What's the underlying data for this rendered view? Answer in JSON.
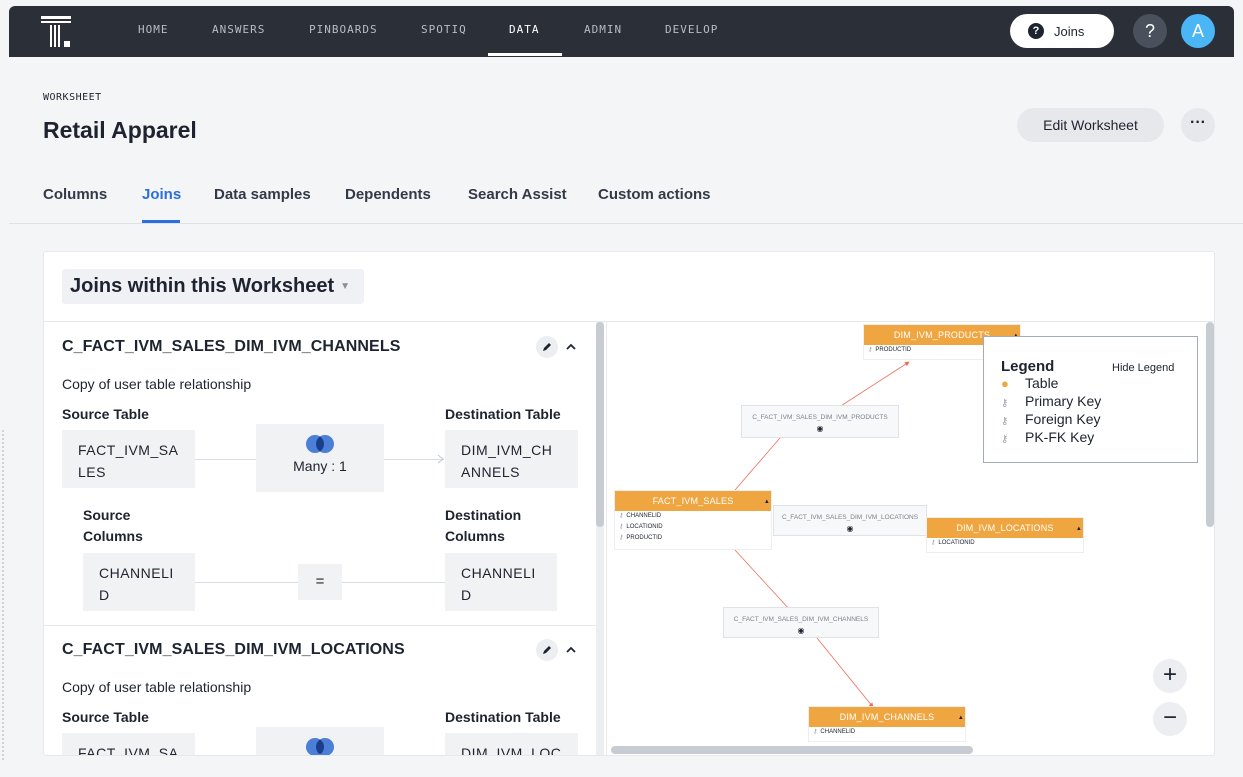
{
  "nav": {
    "items": [
      "HOME",
      "ANSWERS",
      "PINBOARDS",
      "SPOTIQ",
      "DATA",
      "ADMIN",
      "DEVELOP"
    ],
    "active": "DATA",
    "joins_pill": "Joins",
    "help": "?",
    "avatar": "A"
  },
  "header": {
    "breadcrumb": "WORKSHEET",
    "title": "Retail Apparel",
    "edit_button": "Edit Worksheet",
    "more_button": "···"
  },
  "tabs": [
    "Columns",
    "Joins",
    "Data samples",
    "Dependents",
    "Search Assist",
    "Custom actions"
  ],
  "active_tab": "Joins",
  "panel": {
    "dropdown": "Joins within this Worksheet",
    "joins": [
      {
        "name": "C_FACT_IVM_SALES_DIM_IVM_CHANNELS",
        "description": "Copy of user table relationship",
        "source_label": "Source Table",
        "destination_label": "Destination Table",
        "source_table": [
          "FACT_IVM_SA",
          "LES"
        ],
        "cardinality": "Many : 1",
        "destination_table": [
          "DIM_IVM_CH",
          "ANNELS"
        ],
        "source_columns_label": [
          "Source",
          "Columns"
        ],
        "destination_columns_label": [
          "Destination",
          "Columns"
        ],
        "source_column": [
          "CHANNELI",
          "D"
        ],
        "operator": "=",
        "destination_column": [
          "CHANNELI",
          "D"
        ]
      },
      {
        "name": "C_FACT_IVM_SALES_DIM_IVM_LOCATIONS",
        "description": "Copy of user table relationship",
        "source_label": "Source Table",
        "destination_label": "Destination Table",
        "source_table": [
          "FACT_IVM_SA"
        ],
        "destination_table": [
          "DIM_IVM_LOC"
        ]
      }
    ]
  },
  "diagram": {
    "tables": {
      "products": {
        "name": "DIM_IVM_PRODUCTS",
        "columns": [
          "PRODUCTID"
        ]
      },
      "sales": {
        "name": "FACT_IVM_SALES",
        "columns": [
          "CHANNELID",
          "LOCATIONID",
          "PRODUCTID"
        ]
      },
      "locations": {
        "name": "DIM_IVM_LOCATIONS",
        "columns": [
          "LOCATIONID"
        ]
      },
      "channels": {
        "name": "DIM_IVM_CHANNELS",
        "columns": [
          "CHANNELID"
        ]
      }
    },
    "joins": {
      "products": "C_FACT_IVM_SALES_DIM_IVM_PRODUCTS",
      "locations": "C_FACT_IVM_SALES_DIM_IVM_LOCATIONS",
      "channels": "C_FACT_IVM_SALES_DIM_IVM_CHANNELS"
    },
    "legend": {
      "title": "Legend",
      "hide": "Hide Legend",
      "items": [
        "Table",
        "Primary Key",
        "Foreign Key",
        "PK-FK Key"
      ]
    },
    "zoom_in": "+",
    "zoom_out": "−"
  },
  "colors": {
    "nav_bg": "#2b2f38",
    "accent": "#2a6fdb",
    "table_header": "#f0a640",
    "join_line": "#f06b5c",
    "avatar": "#4ab6f5"
  }
}
